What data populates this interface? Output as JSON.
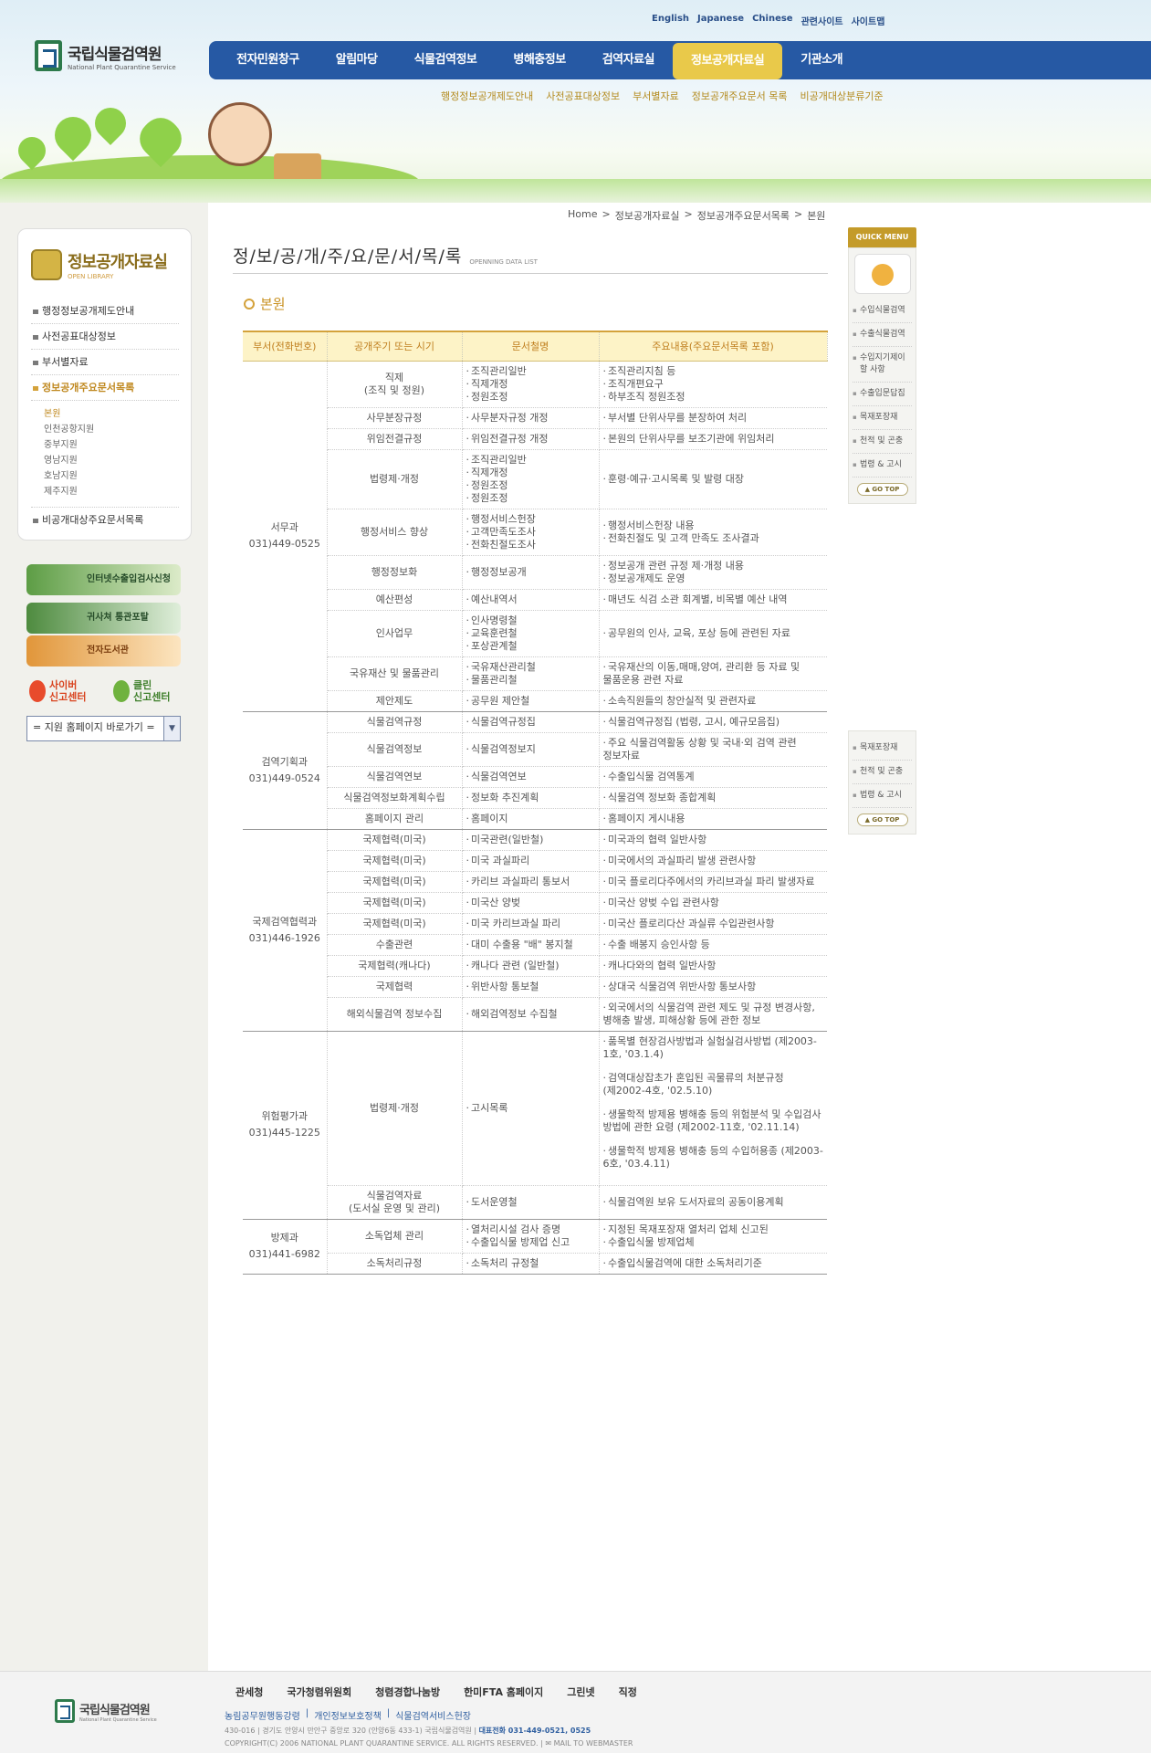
{
  "header": {
    "lang_links": [
      "English",
      "Japanese",
      "Chinese",
      "관련사이트",
      "사이트맵"
    ],
    "logo_title": "국립식물검역원",
    "logo_subtitle": "National Plant Quarantine Service",
    "gnb": [
      "전자민원창구",
      "알림마당",
      "식물검역정보",
      "병해충정보",
      "검역자료실",
      "정보공개자료실",
      "기관소개"
    ],
    "gnb_active": "정보공개자료실",
    "subnav": [
      "행정정보공개제도안내",
      "사전공표대상정보",
      "부서별자료",
      "정보공개주요문서 목록",
      "비공개대상분류기준"
    ]
  },
  "breadcrumb": [
    "Home",
    "정보공개자료실",
    "정보공개주요문서목록",
    "본원"
  ],
  "sidebar": {
    "title": "정보공개자료실",
    "subtitle": "OPEN LIBRARY",
    "items": [
      "행정정보공개제도안내",
      "사전공표대상정보",
      "부서별자료",
      "정보공개주요문서목록"
    ],
    "subitems": [
      "본원",
      "인천공항지원",
      "중부지원",
      "영남지원",
      "호남지원",
      "제주지원"
    ],
    "last_item": "비공개대상주요문서목록",
    "banners": [
      "인터넷수출입검사신청",
      "귀사쳐 통관포탈",
      "전자도서관"
    ],
    "cyber": "사이버\n신고센터",
    "clean": "클린\n신고센터",
    "site_select": "= 지원 홈페이지 바로가기 ="
  },
  "content": {
    "title": "정/보/공/개/주/요/문/서/목/록",
    "title_en": "OPENNING DATA LIST",
    "section": "본원",
    "headers": [
      "부서(전화번호)",
      "공개주기 또는 시기",
      "문서철명",
      "주요내용(주요문서목록 포함)"
    ]
  },
  "table": [
    {
      "dept": "서무과",
      "phone": "031)449-0525",
      "rows": [
        {
          "period": "직제\n(조직 및 정원)",
          "docs": [
            "조직관리일반",
            "직제개정",
            "정원조정"
          ],
          "content": [
            "조직관리지침 등",
            "조직개편요구",
            "하부조직 정원조정"
          ]
        },
        {
          "period": "사무분장규정",
          "docs": [
            "사무분자규정 개정"
          ],
          "content": [
            "부서별 단위사무를 분장하여 처리"
          ]
        },
        {
          "period": "위임전결규정",
          "docs": [
            "위임전결규정 개정"
          ],
          "content": [
            "본원의 단위사무를 보조기관에 위임처리"
          ]
        },
        {
          "period": "법령제·개정",
          "docs": [
            "조직관리일반",
            "직제개정",
            "정원조정",
            "정원조정"
          ],
          "content": [
            "훈령·예규·고시목록 및 발령 대장"
          ]
        },
        {
          "period": "행정서비스 향상",
          "docs": [
            "행정서비스헌장",
            "고객만족도조사",
            "전화친절도조사"
          ],
          "content": [
            "행정서비스헌장 내용",
            "전화친절도 및 고객 만족도 조사결과"
          ]
        },
        {
          "period": "행정정보화",
          "docs": [
            "행정정보공개"
          ],
          "content": [
            "정보공개 관련 규정 제·개정 내용",
            "정보공개제도 운영"
          ]
        },
        {
          "period": "예산편성",
          "docs": [
            "예산내역서"
          ],
          "content": [
            "매년도 식검 소관 회계별, 비목별 예산 내역"
          ]
        },
        {
          "period": "인사업무",
          "docs": [
            "인사명령철",
            "교육훈련철",
            "포상관계철"
          ],
          "content": [
            "공무원의 인사, 교육, 포상 등에 관련된 자료"
          ]
        },
        {
          "period": "국유재산 및 물품관리",
          "docs": [
            "국유재산관리철",
            "물품관리철"
          ],
          "content": [
            "국유재산의 이동,매매,양여, 관리환 등 자료 및 물품운용 관련 자료"
          ]
        },
        {
          "period": "제안제도",
          "docs": [
            "공무원 제안철"
          ],
          "content": [
            "소속직원들의 창안실적 및 관련자료"
          ]
        }
      ]
    },
    {
      "dept": "검역기획과",
      "phone": "031)449-0524",
      "rows": [
        {
          "period": "식물검역규정",
          "docs": [
            "식물검역규정집"
          ],
          "content": [
            "식물검역규정집 (법령, 고시, 예규모음집)"
          ]
        },
        {
          "period": "식물검역정보",
          "docs": [
            "식물검역정보지"
          ],
          "content": [
            "주요 식물검역활동 상황 및 국내·외 검역 관련 정보자료"
          ]
        },
        {
          "period": "식물검역연보",
          "docs": [
            "식물검역연보"
          ],
          "content": [
            "수출입식물 검역통계"
          ]
        },
        {
          "period": "식물검역정보화계획수립",
          "docs": [
            "정보화 추진계획"
          ],
          "content": [
            "식물검역 정보화 종합계획"
          ]
        },
        {
          "period": "홈페이지 관리",
          "docs": [
            "홈페이지"
          ],
          "content": [
            "홈페이지 게시내용"
          ]
        }
      ]
    },
    {
      "dept": "국제검역협력과",
      "phone": "031)446-1926",
      "rows": [
        {
          "period": "국제협력(미국)",
          "docs": [
            "미국관련(일반철)"
          ],
          "content": [
            "미국과의 협력 일반사항"
          ]
        },
        {
          "period": "국제협력(미국)",
          "docs": [
            "미국 과실파리"
          ],
          "content": [
            "미국에서의 과실파리 발생 관련사항"
          ]
        },
        {
          "period": "국제협력(미국)",
          "docs": [
            "카리브 과실파리 통보서"
          ],
          "content": [
            "미국 플로리다주에서의 카리브과실 파리 발생자료"
          ]
        },
        {
          "period": "국제협력(미국)",
          "docs": [
            "미국산 양벚"
          ],
          "content": [
            "미국산 양벚 수입 관련사항"
          ]
        },
        {
          "period": "국제협력(미국)",
          "docs": [
            "미국 카리브과실 파리"
          ],
          "content": [
            "미국산 플로리다산 과실류 수입관련사항"
          ]
        },
        {
          "period": "수출관련",
          "docs": [
            "대미 수출용 \"배\" 봉지철"
          ],
          "content": [
            "수출 배봉지 승인사항 등"
          ]
        },
        {
          "period": "국제협력(캐나다)",
          "docs": [
            "캐나다 관련 (일반철)"
          ],
          "content": [
            "캐나다와의 협력 일반사항"
          ]
        },
        {
          "period": "국제협력",
          "docs": [
            "위반사항 통보철"
          ],
          "content": [
            "상대국 식물검역 위반사항 통보사항"
          ]
        },
        {
          "period": "해외식물검역 정보수집",
          "docs": [
            "해외검역정보 수집철"
          ],
          "content": [
            "외국에서의 식물검역 관련 제도 및 규정 변경사항, 병해충 발생, 피해상황 등에 관한 정보"
          ]
        }
      ]
    },
    {
      "dept": "위험평가과",
      "phone": "031)445-1225",
      "rows": [
        {
          "period": "법령제·개정",
          "docs": [
            "고시목록"
          ],
          "content": [
            "품목별 현장검사방법과 실험실검사방법 (제2003-1호, '03.1.4)",
            "검역대상잡초가 혼입된 곡물류의 처분규정 (제2002-4호, '02.5.10)",
            "생물학적 방제용 병해충 등의 위험분석 및 수입검사 방법에 관한 요령 (제2002-11호, '02.11.14)",
            "생물학적 방제용 병해충 등의 수입허용종 (제2003-6호, '03.4.11)"
          ]
        },
        {
          "period": "식물검역자료\n(도서실 운영 및 관리)",
          "docs": [
            "도서운영철"
          ],
          "content": [
            "식물검역원 보유 도서자료의 공동이용계획"
          ]
        }
      ]
    },
    {
      "dept": "방제과",
      "phone": "031)441-6982",
      "rows": [
        {
          "period": "소독업체 관리",
          "docs": [
            "열처리시설 검사 증명",
            "수출입식물 방제업 신고"
          ],
          "content": [
            "지정된 목재포장재 열처리 업체 신고된",
            "수출입식물 방제업체"
          ]
        },
        {
          "period": "소독처리규정",
          "docs": [
            "소독처리 규정철"
          ],
          "content": [
            "수출입식물검역에 대한 소독처리기준"
          ]
        }
      ]
    }
  ],
  "quick": {
    "title": "QUICK MENU",
    "items": [
      "수입식물검역",
      "수출식물검역",
      "수입지기제이할 사항",
      "수출입문답집",
      "목재포장재",
      "천적 및 곤충",
      "법령 & 고시"
    ],
    "items2": [
      "목재포장재",
      "천적 및 곤충",
      "법령 & 고시"
    ],
    "gotop": "GO TOP"
  },
  "footer": {
    "logo_title": "국립식물검역원",
    "logo_subtitle": "National Plant Quarantine Service",
    "partners": [
      "관세청",
      "국가청렴위원회",
      "청렴경합나눔방",
      "한미FTA 홈페이지",
      "그린넷",
      "직정"
    ],
    "links": [
      "농림공무원행동강령",
      "개인정보보호정책",
      "식물검역서비스헌장"
    ],
    "address": "430-016 | 경기도 안양시 만안구 중앙로 320 (안양6동 433-1) 국립식물검역원 |",
    "phone": "대표전화 031-449-0521, 0525",
    "copyright": "COPYRIGHT(C) 2006 NATIONAL PLANT QUARANTINE SERVICE. ALL RIGHTS RESERVED. |",
    "mail": "MAIL TO WEBMASTER"
  },
  "colors": {
    "gnb": "#2659a4",
    "accent": "#d4a23b",
    "header_bg": "#fdf3c7"
  }
}
